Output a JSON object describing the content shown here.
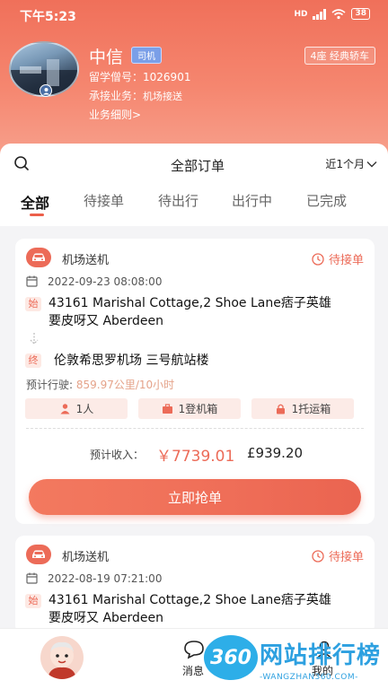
{
  "status_bar": {
    "time": "下午5:23",
    "network": "HD",
    "battery": "38"
  },
  "profile": {
    "name": "中信",
    "role_tag": "司机",
    "car_type": "4座 经典轿车",
    "student_no_label": "留学僧号：",
    "student_no": "1026901",
    "service_label": "承接业务：",
    "service": "机场接送",
    "details_link": "业务细则>"
  },
  "header": {
    "title": "全部订单",
    "range": "近1个月"
  },
  "tabs": [
    {
      "label": "全部",
      "active": true
    },
    {
      "label": "待接单",
      "active": false
    },
    {
      "label": "待出行",
      "active": false
    },
    {
      "label": "出行中",
      "active": false
    },
    {
      "label": "已完成",
      "active": false
    }
  ],
  "orders": [
    {
      "service": "机场送机",
      "status": "待接单",
      "datetime": "2022-09-23 08:08:00",
      "start_badge": "始",
      "start_line1": "43161 Marishal Cottage,2 Shoe Lane痞子英雄",
      "start_line2": "要皮呀又 Aberdeen",
      "end_badge": "终",
      "end": "伦敦希思罗机场 三号航站楼",
      "estimate_label": "预计行驶:",
      "estimate": "859.97公里/10小时",
      "passengers": "1人",
      "boarding_bags": "1登机箱",
      "checked_bags": "1托运箱",
      "income_label": "预计收入：",
      "income_cny": "￥7739.01",
      "income_gbp": "£939.20",
      "button": "立即抢单"
    },
    {
      "service": "机场送机",
      "status": "待接单",
      "datetime": "2022-08-19 07:21:00",
      "start_badge": "始",
      "start_line1": "43161 Marishal Cottage,2 Shoe Lane痞子英雄",
      "start_line2": "要皮呀又 Aberdeen"
    }
  ],
  "bottom_nav": {
    "messages": "消息",
    "me": "我的"
  },
  "watermark": {
    "badge": "360",
    "title": "网站排行榜",
    "subtitle": "-WANGZHAN360.COM-"
  },
  "colors": {
    "accent": "#ec6b58",
    "header_start": "#f0705a",
    "header_end": "#f7a08c"
  }
}
